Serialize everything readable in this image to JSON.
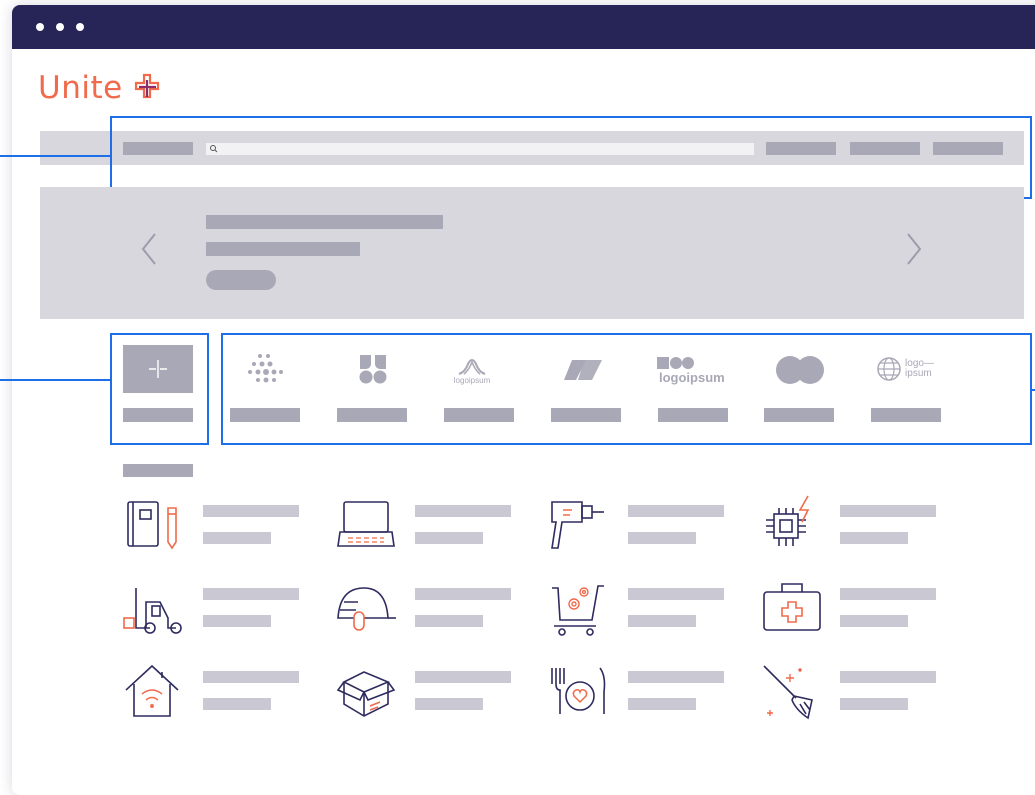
{
  "brand": {
    "name": "Unite",
    "logo_icon": "intertwined-cross-icon",
    "accent_color": "#f06a4b",
    "secondary_color": "#7b2f6e"
  },
  "window": {
    "titlebar_color": "#272458",
    "controls": [
      "dot",
      "dot",
      "dot"
    ]
  },
  "highlight_color": "#1e6ee8",
  "placeholder_color": "#a9a8b6",
  "brand_logos": [
    {
      "name": "dots-logo",
      "text": ""
    },
    {
      "name": "clover-logo",
      "text": ""
    },
    {
      "name": "logoipsum-arch",
      "text": "logoipsum"
    },
    {
      "name": "parallelogram-logo",
      "text": ""
    },
    {
      "name": "logoipsum-blocks",
      "text": "logoipsum"
    },
    {
      "name": "circles-logo",
      "text": ""
    },
    {
      "name": "globe-logo",
      "text": "logo—\nipsum"
    }
  ],
  "category_icons": [
    "notebook-pencil-icon",
    "laptop-icon",
    "drill-icon",
    "chip-power-icon",
    "forklift-icon",
    "helmet-mouse-icon",
    "shopping-cart-gear-icon",
    "first-aid-kit-icon",
    "smart-home-icon",
    "box-icon",
    "dining-heart-icon",
    "broom-icon"
  ]
}
